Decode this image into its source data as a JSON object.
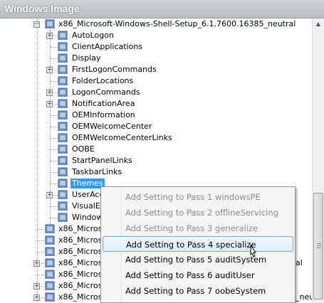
{
  "window": {
    "title": "Windows Image"
  },
  "tree": {
    "root_label": "x86_Microsoft-Windows-Shell-Setup_6.1.7600.16385_neutral",
    "children": [
      {
        "label": "AutoLogon",
        "expandable": true
      },
      {
        "label": "ClientApplications",
        "expandable": false
      },
      {
        "label": "Display",
        "expandable": false
      },
      {
        "label": "FirstLogonCommands",
        "expandable": true
      },
      {
        "label": "FolderLocations",
        "expandable": false
      },
      {
        "label": "LogonCommands",
        "expandable": true
      },
      {
        "label": "NotificationArea",
        "expandable": true
      },
      {
        "label": "OEMInformation",
        "expandable": false
      },
      {
        "label": "OEMWelcomeCenter",
        "expandable": false
      },
      {
        "label": "OEMWelcomeCenterLinks",
        "expandable": false
      },
      {
        "label": "OOBE",
        "expandable": false
      },
      {
        "label": "StartPanelLinks",
        "expandable": false
      },
      {
        "label": "TaskbarLinks",
        "expandable": false
      },
      {
        "label": "Themes",
        "expandable": false,
        "selected": true
      },
      {
        "label": "UserAcc",
        "expandable": true
      },
      {
        "label": "VisualEf",
        "expandable": false
      },
      {
        "label": "Window",
        "expandable": false
      }
    ],
    "siblings": [
      {
        "label": "x86_Microsoft",
        "expandable": false
      },
      {
        "label": "x86_Microsoft",
        "expandable": false
      },
      {
        "label": "x86_Microsoft",
        "expandable": false
      },
      {
        "label": "x86_Microsoft",
        "expandable": true
      },
      {
        "label": "x86_Microsoft",
        "expandable": false
      },
      {
        "label": "x86_Microsoft",
        "expandable": true
      },
      {
        "label": "x86_Microsoft",
        "expandable": true
      }
    ],
    "right_fragments": {
      "row4": "al",
      "row7": "_neu"
    }
  },
  "context_menu": {
    "items": [
      {
        "label": "Add Setting to Pass 1 windowsPE",
        "enabled": false
      },
      {
        "label": "Add Setting to Pass 2 offlineServicing",
        "enabled": false
      },
      {
        "label": "Add Setting to Pass 3 generalize",
        "enabled": false
      },
      {
        "label": "Add Setting to Pass 4 specialize",
        "enabled": true,
        "hover": true
      },
      {
        "label": "Add Setting to Pass 5 auditSystem",
        "enabled": true
      },
      {
        "label": "Add Setting to Pass 6 auditUser",
        "enabled": true
      },
      {
        "label": "Add Setting to Pass 7 oobeSystem",
        "enabled": true
      }
    ]
  },
  "colors": {
    "selection": "#3399ff",
    "menu_hover_border": "#7da2ce",
    "disabled_text": "#8d8d8d"
  },
  "icons": {
    "node": "component-icon",
    "expand": "plus-icon",
    "collapse": "minus-icon"
  }
}
